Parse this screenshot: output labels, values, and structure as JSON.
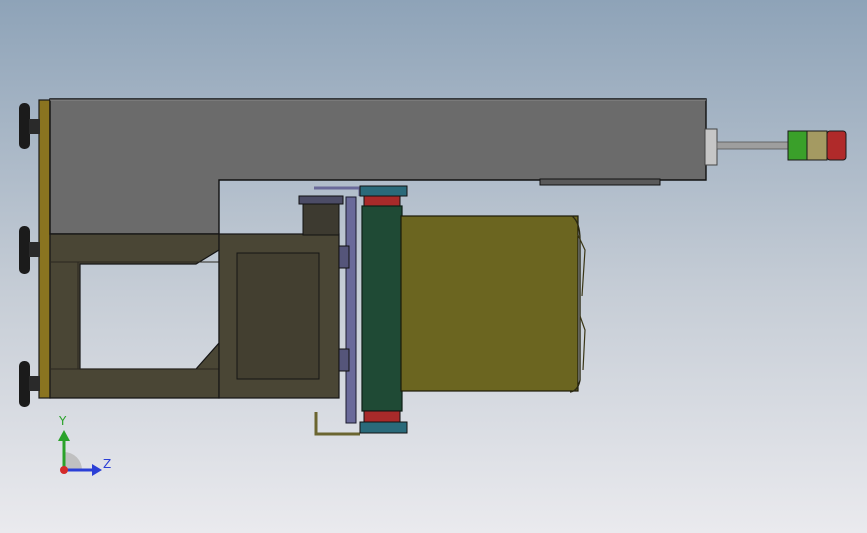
{
  "viewport": {
    "background_top": "#8ea3b8",
    "background_bottom": "#eaeaee"
  },
  "colors": {
    "main_beam": "#6b6b6b",
    "frame": "#4a4635",
    "end_plate": "#8a7420",
    "motor_body": "#6b6520",
    "roller": "#1f4a35",
    "roller_cap": "#a82a2a",
    "flange": "#2a6a7a",
    "bracket": "#6a6a9a",
    "signal_green": "#3aa02a",
    "signal_amber": "#a49a62",
    "signal_red": "#b02a2a",
    "axis_y": "#2aa22a",
    "axis_z": "#2b3fd6",
    "axis_origin": "#d42a2a"
  },
  "triad": {
    "y_label": "Y",
    "z_label": "Z",
    "icon": "coordinate-triad-icon"
  }
}
